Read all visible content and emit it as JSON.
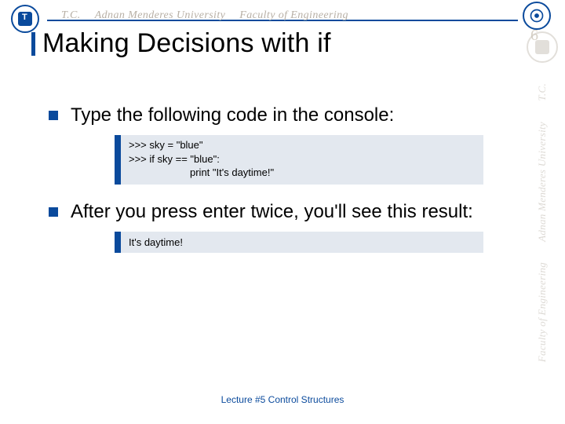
{
  "header": {
    "tc": "T.C.",
    "univ": "Adnan Menderes University",
    "fac": "Faculty of Engineering"
  },
  "title": "Making Decisions with if",
  "bullets": [
    "Type the following code in the console:",
    "After you press enter twice, you'll see this result:"
  ],
  "code1": {
    "l1": ">>> sky = \"blue\"",
    "l2": ">>> if sky == \"blue\":",
    "l3": "print \"It's daytime!\""
  },
  "code2": {
    "l1": "It's daytime!"
  },
  "footer": "Lecture #5 Control Structures",
  "page_number": "6",
  "watermark": {
    "tc": "T.C.",
    "univ": "Adnan Menderes University",
    "fac": "Faculty of Engineering"
  }
}
